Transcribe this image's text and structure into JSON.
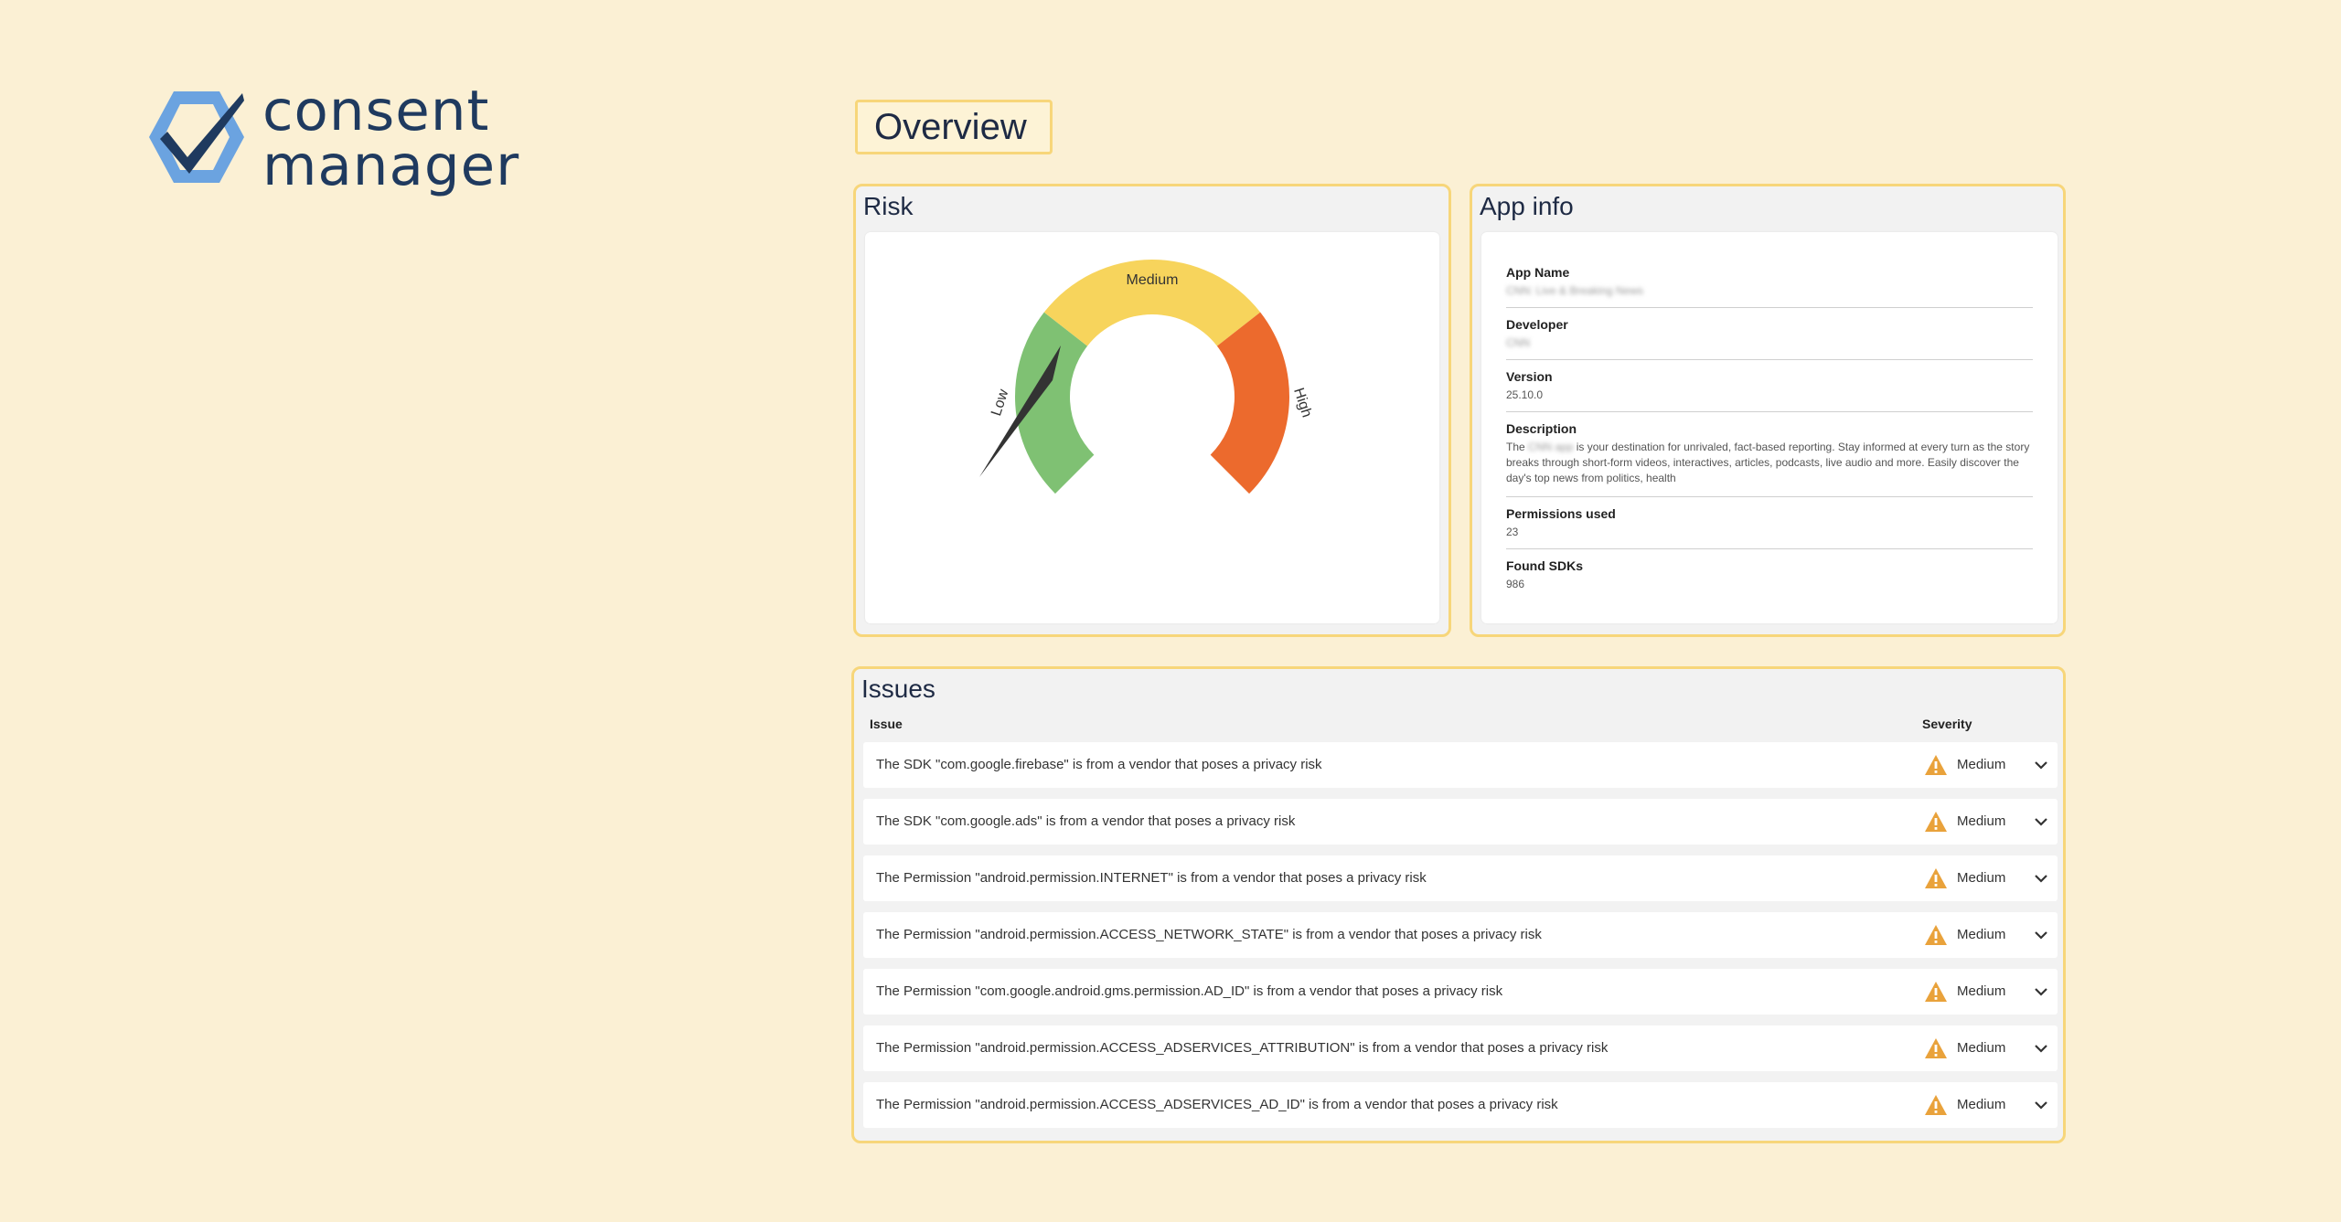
{
  "brand": {
    "logo_line1": "consent",
    "logo_line2": "manager",
    "mark_color": "#6ba3e0",
    "text_color": "#1f3a5f"
  },
  "page": {
    "title": "Overview"
  },
  "risk": {
    "title": "Risk",
    "labels": {
      "low": "Low",
      "medium": "Medium",
      "high": "High"
    },
    "colors": {
      "low": "#7fc173",
      "medium": "#f7d45c",
      "high": "#ec6a2d",
      "needle": "#333333"
    },
    "level": "Medium"
  },
  "app_info": {
    "title": "App info",
    "fields": [
      {
        "label": "App Name",
        "value": "CNN: Live & Breaking News",
        "blurred": true
      },
      {
        "label": "Developer",
        "value": "CNN",
        "blurred": true
      },
      {
        "label": "Version",
        "value": "25.10.0",
        "blurred": false
      },
      {
        "label": "Description",
        "blurred_prefix": "CNN app",
        "value_pre": "The",
        "value_post": "is your destination for unrivaled, fact-based reporting. Stay informed at every turn as the story breaks through short-form videos, interactives, articles, podcasts, live audio and more. Easily discover the day's top news from politics, health"
      },
      {
        "label": "Permissions used",
        "value": "23",
        "blurred": false
      },
      {
        "label": "Found SDKs",
        "value": "986",
        "blurred": false
      }
    ]
  },
  "issues": {
    "title": "Issues",
    "col_issue": "Issue",
    "col_severity": "Severity",
    "rows": [
      {
        "text": "The SDK \"com.google.firebase\" is from a vendor that poses a privacy risk",
        "severity": "Medium"
      },
      {
        "text": "The SDK \"com.google.ads\" is from a vendor that poses a privacy risk",
        "severity": "Medium"
      },
      {
        "text": "The Permission \"android.permission.INTERNET\" is from a vendor that poses a privacy risk",
        "severity": "Medium"
      },
      {
        "text": "The Permission \"android.permission.ACCESS_NETWORK_STATE\" is from a vendor that poses a privacy risk",
        "severity": "Medium"
      },
      {
        "text": "The Permission \"com.google.android.gms.permission.AD_ID\" is from a vendor that poses a privacy risk",
        "severity": "Medium"
      },
      {
        "text": "The Permission \"android.permission.ACCESS_ADSERVICES_ATTRIBUTION\" is from a vendor that poses a privacy risk",
        "severity": "Medium"
      },
      {
        "text": "The Permission \"android.permission.ACCESS_ADSERVICES_AD_ID\" is from a vendor that poses a privacy risk",
        "severity": "Medium"
      }
    ],
    "warning_color": "#e9a23b"
  }
}
